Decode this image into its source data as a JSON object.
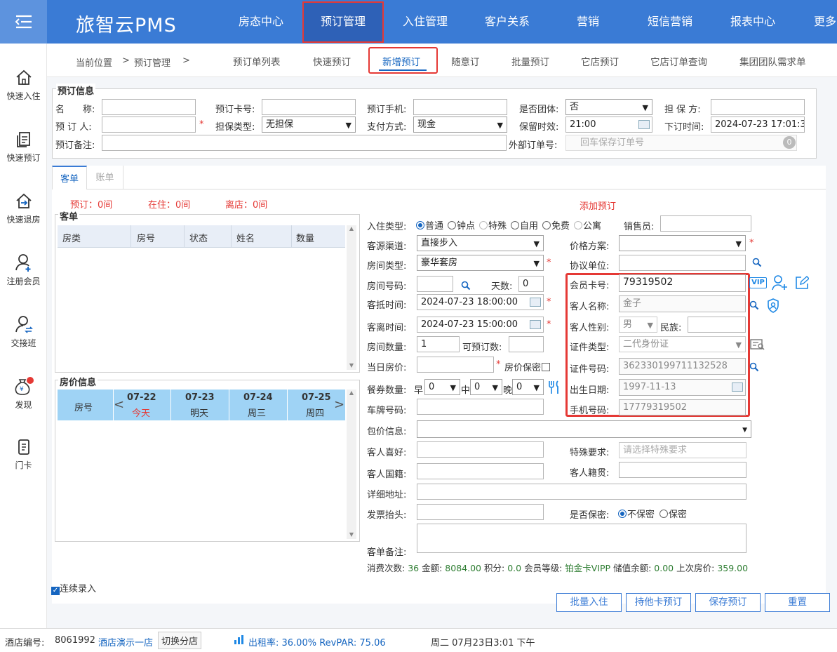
{
  "app": {
    "logo": "旅智云PMS"
  },
  "topnav": [
    "房态中心",
    "预订管理",
    "入住管理",
    "客户关系",
    "营销",
    "短信营销",
    "报表中心",
    "更多"
  ],
  "sidebar": [
    "快速入住",
    "快速预订",
    "快速退房",
    "注册会员",
    "交接班",
    "发现",
    "门卡"
  ],
  "breadcrumb": {
    "current": "当前位置",
    "sep": ">",
    "page": "预订管理",
    "sep2": ">"
  },
  "subtabs": [
    "预订单列表",
    "快速预订",
    "新增预订",
    "随意订",
    "批量预订",
    "它店预订",
    "它店订单查询",
    "集团团队需求单"
  ],
  "booking_info": {
    "legend": "预订信息",
    "name_label": "名　　称:",
    "card_label": "预订卡号:",
    "phone_label": "预订手机:",
    "group_label": "是否团体:",
    "group_value": "否",
    "guarantor_label": "担 保 方:",
    "booker_label": "预 订 人:",
    "guarantee_type_label": "担保类型:",
    "guarantee_type_value": "无担保",
    "pay_label": "支付方式:",
    "pay_value": "现金",
    "hold_label": "保留时效:",
    "hold_value": "21:00",
    "order_time_label": "下订时间:",
    "order_time_value": "2024-07-23 17:01:3",
    "remark_label": "预订备注:",
    "external_label": "外部订单号:",
    "external_placeholder": "回车保存订单号",
    "external_count": "0",
    "required_mark": "*"
  },
  "tabs": [
    "客单",
    "账单"
  ],
  "summary": {
    "booked": "预订：0间",
    "staying": "在住：0间",
    "leaving": "离店：0间",
    "add_booking": "添加预订"
  },
  "guest_list": {
    "legend": "客单",
    "columns": [
      "房类",
      "房号",
      "状态",
      "姓名",
      "数量"
    ]
  },
  "price_info": {
    "legend": "房价信息",
    "room_no": "房号",
    "prev": "<",
    "next": ">",
    "days": [
      {
        "date": "07-22",
        "day": "今天"
      },
      {
        "date": "07-23",
        "day": "明天"
      },
      {
        "date": "07-24",
        "day": "周三"
      },
      {
        "date": "07-25",
        "day": "周四"
      }
    ]
  },
  "continuous": "连续录入",
  "form": {
    "checkin_type_label": "入住类型:",
    "checkin_types": [
      "普通",
      "钟点",
      "特殊",
      "自用",
      "免费",
      "公寓"
    ],
    "sales_label": "销售员:",
    "source_label": "客源渠道:",
    "source_value": "直接步入",
    "price_plan_label": "价格方案:",
    "room_type_label": "房间类型:",
    "room_type_value": "豪华套房",
    "agreement_label": "协议单位:",
    "room_no_label": "房间号码:",
    "days_label": "天数:",
    "days_value": "0",
    "arrive_label": "客抵时间:",
    "arrive_value": "2024-07-23 18:00:00",
    "depart_label": "客离时间:",
    "depart_value": "2024-07-23 15:00:00",
    "room_count_label": "房间数量:",
    "room_count_value": "1",
    "available_label": "可预订数:",
    "day_price_label": "当日房价:",
    "price_secret_label": "房价保密",
    "meal_label": "餐券数量:",
    "breakfast": "早",
    "lunch": "中",
    "dinner": "晚",
    "meal_value": "0",
    "plate_label": "车牌号码:",
    "package_label": "包价信息:",
    "pref_label": "客人喜好:",
    "special_label": "特殊要求:",
    "special_placeholder": "请选择特殊要求",
    "nationality_label": "客人国籍:",
    "native_label": "客人籍贯:",
    "address_label": "详细地址:",
    "invoice_label": "发票抬头:",
    "secret_label": "是否保密:",
    "secret_options": [
      "不保密",
      "保密"
    ],
    "remark_label": "客单备注:"
  },
  "member": {
    "card_label": "会员卡号:",
    "card_value": "79319502",
    "name_label": "客人名称:",
    "name_value": "金子",
    "gender_label": "客人性别:",
    "gender_value": "男",
    "ethnic_label": "民族:",
    "id_type_label": "证件类型:",
    "id_type_value": "二代身份证",
    "id_no_label": "证件号码:",
    "id_no_value": "362330199711132528",
    "birth_label": "出生日期:",
    "birth_value": "1997-11-13",
    "mobile_label": "手机号码:",
    "mobile_value": "17779319502",
    "vip_badge": "VIP"
  },
  "stats": {
    "visits_label": "消费次数:",
    "visits": "36",
    "amount_label": "金额:",
    "amount": "8084.00",
    "points_label": "积分:",
    "points": "0.0",
    "level_label": "会员等级:",
    "level": "铂金卡VIPP",
    "balance_label": "储值余额:",
    "balance": "0.00",
    "last_price_label": "上次房价:",
    "last_price": "359.00"
  },
  "buttons": [
    "批量入住",
    "持他卡预订",
    "保存预订",
    "重置"
  ],
  "statusbar": {
    "hotel_no_label": "酒店编号:",
    "hotel_no": "8061992",
    "hotel_name": "酒店演示一店",
    "switch": "切换分店",
    "occupancy": "出租率: 36.00% RevPAR: 75.06",
    "datetime": "周二 07月23日3:01 下午"
  },
  "colors": {
    "brand": "#3a7bd5",
    "active_nav": "#2e61b7",
    "highlight_border": "#e53935",
    "price_header": "#9fd3f5"
  }
}
